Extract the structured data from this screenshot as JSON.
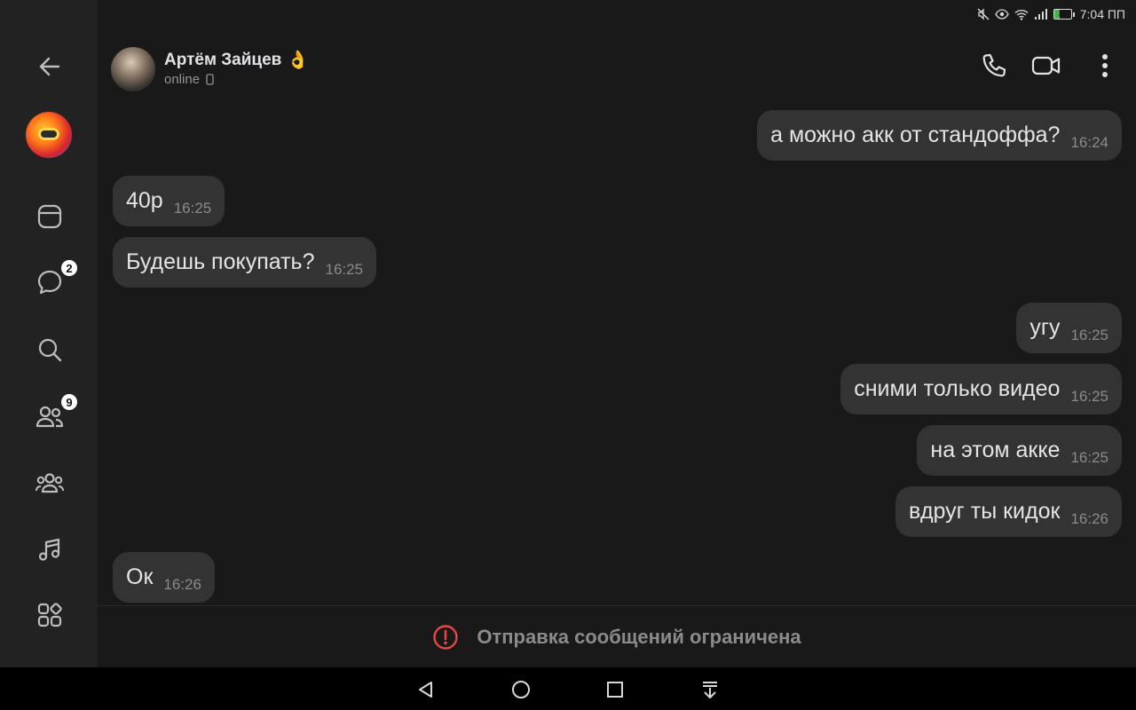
{
  "status_bar": {
    "time": "7:04 ПП",
    "battery_level": "35",
    "icons": [
      "mute-icon",
      "eye-icon",
      "wifi-icon",
      "signal-icon",
      "battery-icon"
    ]
  },
  "sidebar": {
    "items": [
      {
        "name": "back",
        "icon": "back-arrow-icon"
      },
      {
        "name": "profile",
        "icon": "avatar"
      },
      {
        "name": "feed",
        "icon": "feed-icon"
      },
      {
        "name": "messages",
        "icon": "chat-bubble-icon",
        "badge": "2"
      },
      {
        "name": "search",
        "icon": "search-icon"
      },
      {
        "name": "friends",
        "icon": "friends-icon",
        "badge": "9"
      },
      {
        "name": "communities",
        "icon": "communities-icon"
      },
      {
        "name": "music",
        "icon": "music-icon"
      },
      {
        "name": "services",
        "icon": "apps-grid-icon"
      }
    ]
  },
  "header": {
    "name": "Артём Зайцев",
    "emoji": "👌",
    "status": "online",
    "actions": [
      "phone-icon",
      "video-call-icon",
      "more-icon"
    ]
  },
  "messages": [
    {
      "side": "out",
      "text": "а можно акк от стандоффа?",
      "time": "16:24"
    },
    {
      "side": "in",
      "text": "40р",
      "time": "16:25"
    },
    {
      "side": "in",
      "text": "Будешь покупать?",
      "time": "16:25"
    },
    {
      "side": "out",
      "text": "угу",
      "time": "16:25"
    },
    {
      "side": "out",
      "text": "сними только видео",
      "time": "16:25"
    },
    {
      "side": "out",
      "text": "на этом акке",
      "time": "16:25"
    },
    {
      "side": "out",
      "text": "вдруг ты кидок",
      "time": "16:26"
    },
    {
      "side": "in",
      "text": "Ок",
      "time": "16:26"
    }
  ],
  "footer": {
    "text": "Отправка сообщений ограничена",
    "icon": "warning-circle-icon",
    "icon_color": "#e64646"
  },
  "colors": {
    "background": "#191919",
    "sidebar": "#222222",
    "bubble": "#333333",
    "text": "#e4e4e4",
    "time": "#8a8a8a",
    "warning": "#e64646"
  }
}
